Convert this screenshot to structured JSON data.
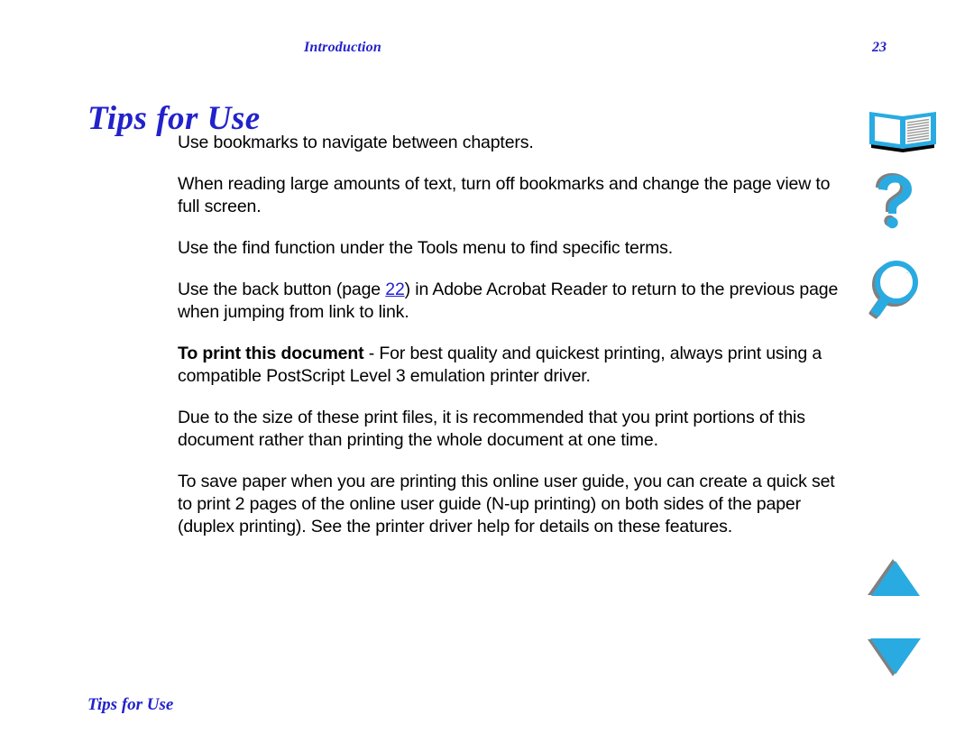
{
  "header": {
    "running_title": "Introduction",
    "page_number": "23"
  },
  "title": "Tips for Use",
  "footer": {
    "section_title": "Tips for Use"
  },
  "colors": {
    "heading_blue": "#2222cc",
    "link_blue": "#2222cc",
    "icon_cyan": "#29abe2",
    "icon_shadow_gray": "#808080",
    "body_black": "#000000",
    "page_background": "#ffffff"
  },
  "body": {
    "paragraphs": [
      {
        "id": "bookmarks-tip",
        "runs": [
          {
            "text": "Use bookmarks to navigate between chapters.",
            "style": "normal"
          }
        ]
      },
      {
        "id": "full-screen-tip",
        "runs": [
          {
            "text": "When reading large amounts of text, turn off bookmarks and change the page view to full screen.",
            "style": "normal"
          }
        ]
      },
      {
        "id": "find-function-tip",
        "runs": [
          {
            "text": "Use the find function under the Tools menu to find specific terms.",
            "style": "normal"
          }
        ]
      },
      {
        "id": "back-button-tip",
        "runs": [
          {
            "text": "Use the back button (page ",
            "style": "normal"
          },
          {
            "text": "22",
            "style": "link"
          },
          {
            "text": ") in Adobe Acrobat Reader to return to the previous page when jumping from link to link.",
            "style": "normal"
          }
        ]
      },
      {
        "id": "print-document-tip",
        "runs": [
          {
            "text": "To print this document",
            "style": "bold"
          },
          {
            "text": " - For best quality and quickest printing, always print using a compatible PostScript Level 3 emulation printer driver.",
            "style": "normal"
          }
        ]
      },
      {
        "id": "print-portions-tip",
        "runs": [
          {
            "text": "Due to the size of these print files, it is recommended that you print portions of this document rather than printing the whole document at one time.",
            "style": "normal"
          }
        ]
      },
      {
        "id": "save-paper-tip",
        "runs": [
          {
            "text": "To save paper when you are printing this online user guide, you can create a quick set to print 2 pages of the online user guide (N-up printing) on both sides of the paper (duplex printing). See the printer driver help for details on these features.",
            "style": "normal"
          }
        ]
      }
    ]
  },
  "nav_icons": [
    {
      "id": "bookmarks",
      "icon": "open-book-icon",
      "label": "Bookmarks"
    },
    {
      "id": "help",
      "icon": "question-mark-icon",
      "label": "Help"
    },
    {
      "id": "search",
      "icon": "magnifying-glass-icon",
      "label": "Find"
    },
    {
      "id": "previous",
      "icon": "triangle-up-icon",
      "label": "Previous page"
    },
    {
      "id": "next",
      "icon": "triangle-down-icon",
      "label": "Next page"
    }
  ]
}
